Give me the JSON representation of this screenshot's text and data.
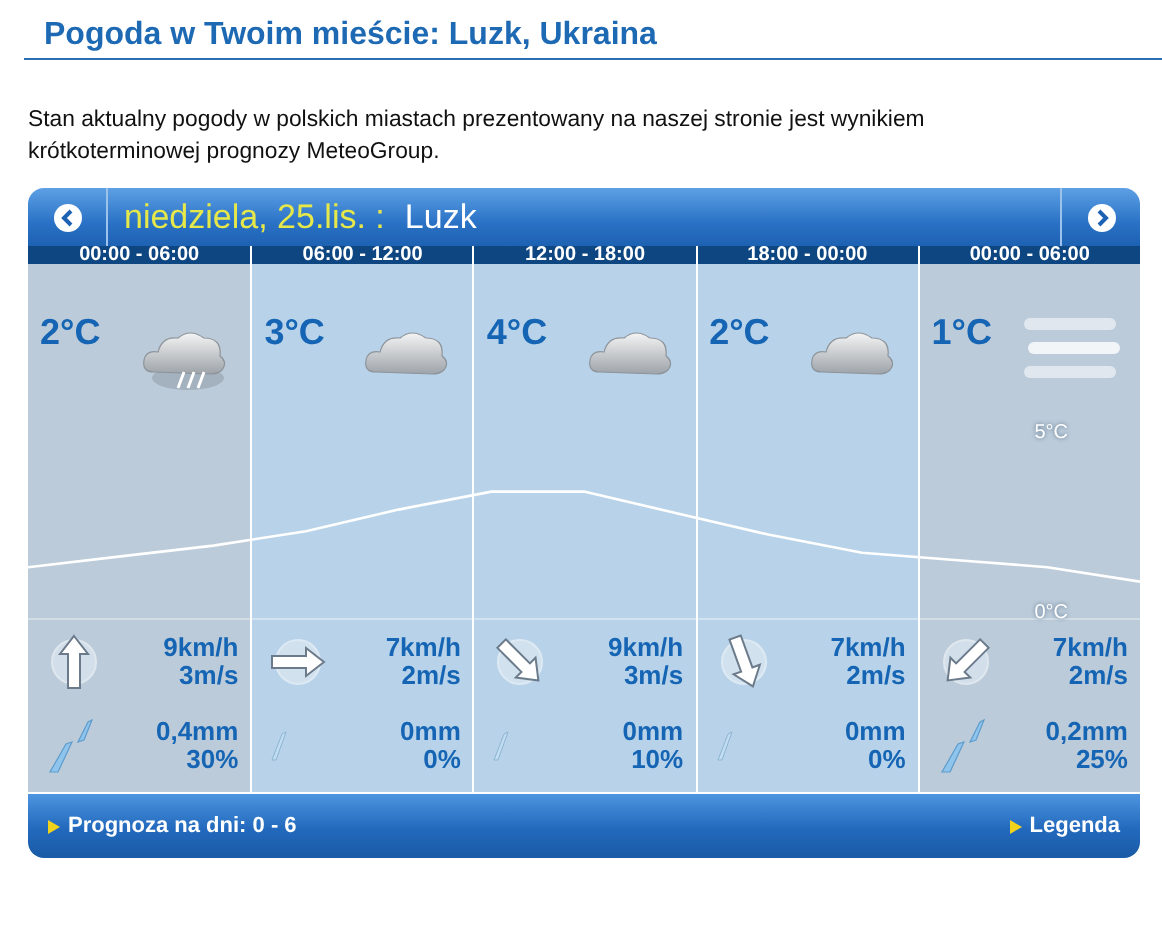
{
  "page_title": "Pogoda w Twoim mieście: Luzk, Ukraina",
  "intro": "Stan aktualny pogody w polskich miastach prezentowany na naszej stronie jest wynikiem krótkoterminowej prognozy MeteoGroup.",
  "widget": {
    "day": "niedziela, 25.lis. :",
    "city": "Luzk",
    "periods": [
      {
        "time": "00:00 - 06:00",
        "night": true,
        "temperature": "2°C",
        "kind": "rain",
        "wind": {
          "kind": "up",
          "kmh": "9km/h",
          "ms": "3m/s"
        },
        "precipitation": {
          "kind": "heavy",
          "amount": "0,4mm",
          "probability": "30%"
        }
      },
      {
        "time": "06:00 - 12:00",
        "night": false,
        "temperature": "3°C",
        "kind": "cloudy",
        "wind": {
          "kind": "right",
          "kmh": "7km/h",
          "ms": "2m/s"
        },
        "precipitation": {
          "kind": "light",
          "amount": "0mm",
          "probability": "0%"
        }
      },
      {
        "time": "12:00 - 18:00",
        "night": false,
        "temperature": "4°C",
        "kind": "cloudy",
        "wind": {
          "kind": "downright",
          "kmh": "9km/h",
          "ms": "3m/s"
        },
        "precipitation": {
          "kind": "light",
          "amount": "0mm",
          "probability": "10%"
        }
      },
      {
        "time": "18:00 - 00:00",
        "night": false,
        "temperature": "2°C",
        "kind": "cloudy",
        "wind": {
          "kind": "down",
          "kmh": "7km/h",
          "ms": "2m/s"
        },
        "precipitation": {
          "kind": "light",
          "amount": "0mm",
          "probability": "0%"
        }
      },
      {
        "time": "00:00 - 06:00",
        "night": true,
        "temperature": "1°C",
        "kind": "fog",
        "wind": {
          "kind": "downleft",
          "kmh": "7km/h",
          "ms": "2m/s"
        },
        "precipitation": {
          "kind": "heavy",
          "amount": "0,2mm",
          "probability": "25%"
        }
      }
    ],
    "chart_data": {
      "type": "line",
      "categories": [
        null,
        null,
        null,
        null,
        null,
        null,
        null,
        null,
        null,
        null,
        null,
        null,
        null
      ],
      "series": [
        {
          "color": "#ffffff",
          "values": [
            1.3,
            1.6,
            1.9,
            2.3,
            2.9,
            3.4,
            3.4,
            2.8,
            2.2,
            1.7,
            1.5,
            1.3,
            0.9
          ]
        }
      ],
      "ylim": [
        0,
        5
      ],
      "yticks": [
        {
          "value": 5,
          "label": "5°C"
        },
        {
          "value": 0,
          "label": "0°C"
        }
      ]
    },
    "footer_left": "Prognoza na dni: 0 - 6",
    "footer_right": "Legenda"
  }
}
